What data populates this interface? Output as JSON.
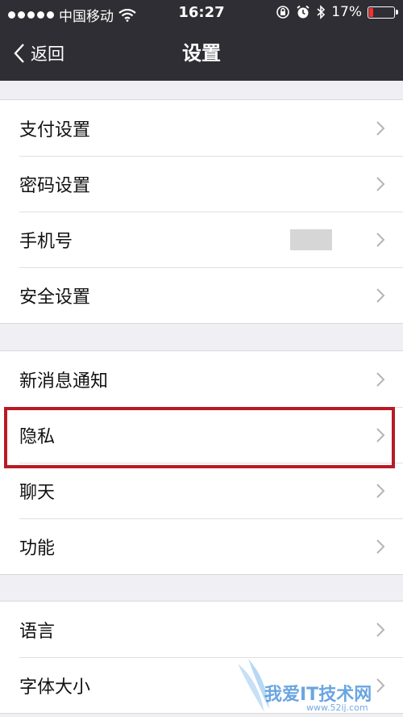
{
  "status_bar": {
    "carrier": "中国移动",
    "time": "16:27",
    "battery_percent": "17%",
    "battery_level": 0.17,
    "icons": [
      "signal-dots-icon",
      "wifi-icon",
      "orientation-lock-icon",
      "alarm-icon",
      "bluetooth-icon",
      "battery-icon"
    ]
  },
  "navbar": {
    "back_label": "返回",
    "title": "设置"
  },
  "groups": [
    {
      "items": [
        {
          "label": "支付设置"
        },
        {
          "label": "密码设置"
        },
        {
          "label": "手机号"
        },
        {
          "label": "安全设置"
        }
      ]
    },
    {
      "items": [
        {
          "label": "新消息通知"
        },
        {
          "label": "隐私"
        },
        {
          "label": "聊天"
        },
        {
          "label": "功能"
        }
      ]
    },
    {
      "items": [
        {
          "label": "语言"
        },
        {
          "label": "字体大小"
        }
      ]
    }
  ],
  "watermark": {
    "text": "我爱IT技术网",
    "site": "www.52ij.com"
  },
  "colors": {
    "header_bg": "#2e2e34",
    "page_bg": "#efeff4",
    "highlight": "#b81a25",
    "battery_low": "#ff2d2d"
  }
}
